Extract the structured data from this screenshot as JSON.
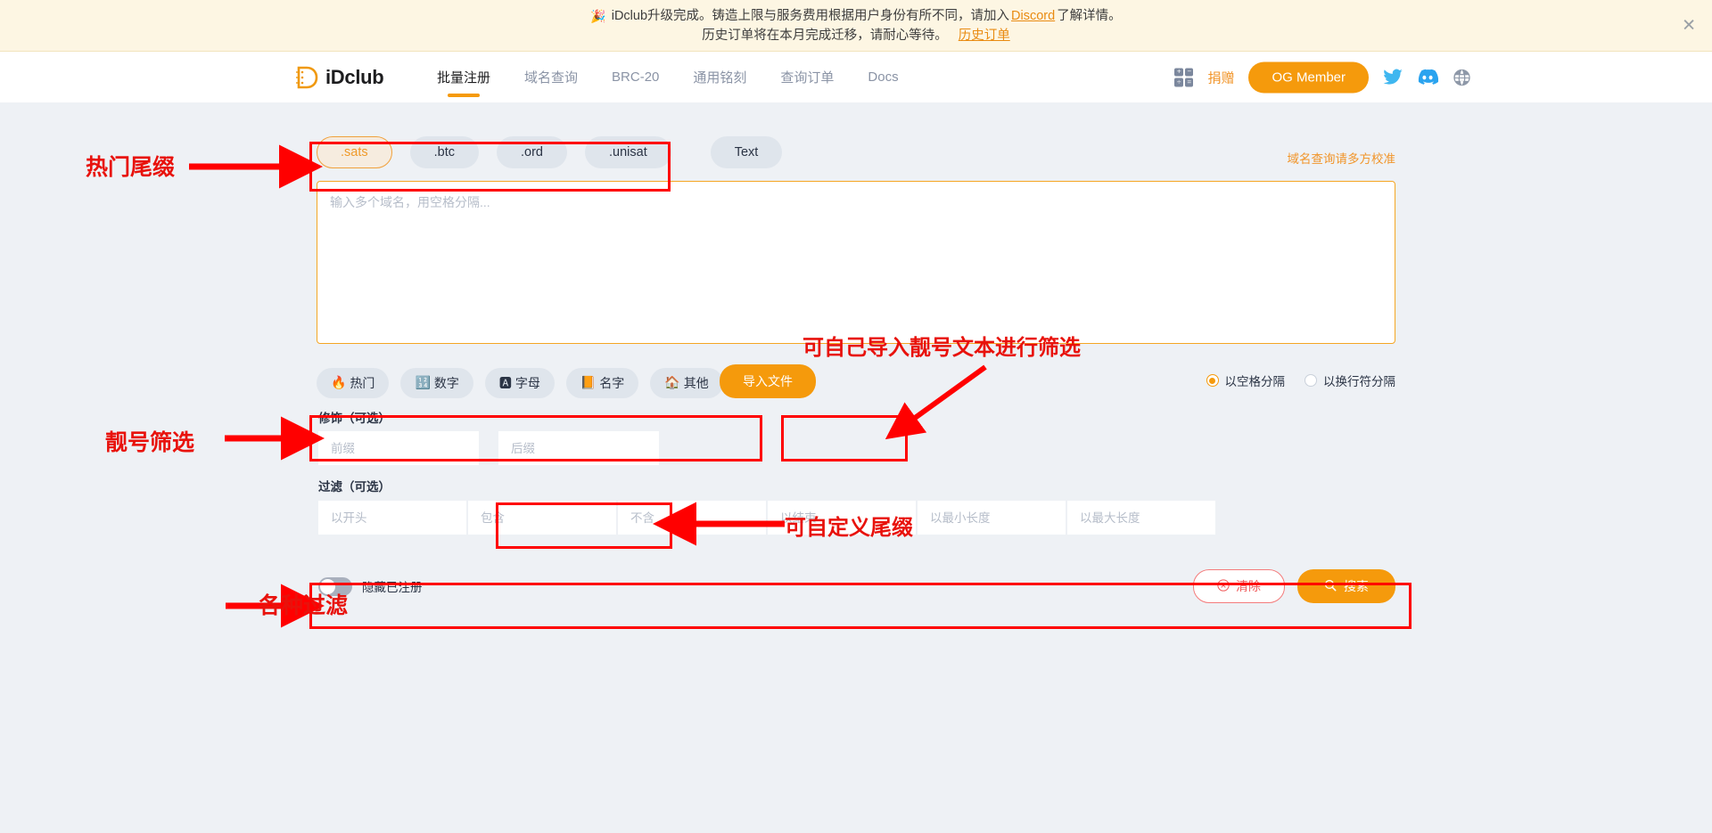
{
  "banner": {
    "emoji": "🎉",
    "line1_a": "iDclub升级完成。铸造上限与服务费用根据用户身份有所不同，请加入",
    "line1_link": "Discord",
    "line1_b": "了解详情。",
    "line2": "历史订单将在本月完成迁移，请耐心等待。",
    "line2_link": "历史订单",
    "close": "✕"
  },
  "header": {
    "logo_text": "iDclub",
    "nav": [
      {
        "label": "批量注册",
        "active": true
      },
      {
        "label": "域名查询",
        "active": false
      },
      {
        "label": "BRC-20",
        "active": false
      },
      {
        "label": "通用铭刻",
        "active": false
      },
      {
        "label": "查询订单",
        "active": false
      },
      {
        "label": "Docs",
        "active": false
      }
    ],
    "calc_cells": [
      "+",
      "−",
      "÷",
      "="
    ],
    "donate_label": "捐赠",
    "og_label": "OG Member",
    "social": [
      {
        "name": "twitter-icon",
        "color": "#3fb7f0"
      },
      {
        "name": "discord-icon",
        "color": "#2aa3ef"
      },
      {
        "name": "globe-icon",
        "color": "#8e98a8"
      }
    ]
  },
  "suffixes": [
    {
      "label": ".sats",
      "active": true
    },
    {
      "label": ".btc",
      "active": false
    },
    {
      "label": ".ord",
      "active": false
    },
    {
      "label": ".unisat",
      "active": false
    }
  ],
  "text_tab": {
    "label": "Text"
  },
  "hint_link": "域名查询请多方校准",
  "textarea": {
    "placeholder": "输入多个域名，用空格分隔...",
    "value": ""
  },
  "filter_chips": [
    {
      "emoji": "🔥",
      "label": "热门"
    },
    {
      "emoji": "🔢",
      "label": "数字"
    },
    {
      "emoji": "🅰",
      "label": "字母"
    },
    {
      "emoji": "📙",
      "label": "名字"
    },
    {
      "emoji": "🏠",
      "label": "其他"
    }
  ],
  "import_button": "导入文件",
  "separator_options": [
    {
      "label": "以空格分隔",
      "selected": true
    },
    {
      "label": "以换行符分隔",
      "selected": false
    }
  ],
  "modifier_section": {
    "label": "修饰（可选）",
    "inputs": [
      {
        "placeholder": "前缀",
        "value": ""
      },
      {
        "placeholder": "后缀",
        "value": ""
      }
    ]
  },
  "filter_section": {
    "label": "过滤（可选）",
    "inputs": [
      {
        "placeholder": "以开头",
        "value": ""
      },
      {
        "placeholder": "包含",
        "value": ""
      },
      {
        "placeholder": "不含",
        "value": ""
      },
      {
        "placeholder": "以结束",
        "value": ""
      },
      {
        "placeholder": "以最小长度",
        "value": ""
      },
      {
        "placeholder": "以最大长度",
        "value": ""
      }
    ]
  },
  "bottom": {
    "toggle_label": "隐藏已注册",
    "toggle_on": false,
    "clear_label": "清除",
    "search_label": "搜索"
  },
  "annotations": [
    {
      "id": "remen",
      "text": "热门尾缀"
    },
    {
      "id": "lianghao",
      "text": "靓号筛选"
    },
    {
      "id": "guolv",
      "text": "各种过滤"
    },
    {
      "id": "weizhui",
      "text": "可自己导入靓号文本进行筛选"
    },
    {
      "id": "zidingyi",
      "text": "可自定义尾缀"
    }
  ],
  "colors": {
    "accent": "#f59a0c",
    "annotation": "#e8120c",
    "banner_bg": "#fdf6e3",
    "page_bg": "#eef1f5"
  }
}
